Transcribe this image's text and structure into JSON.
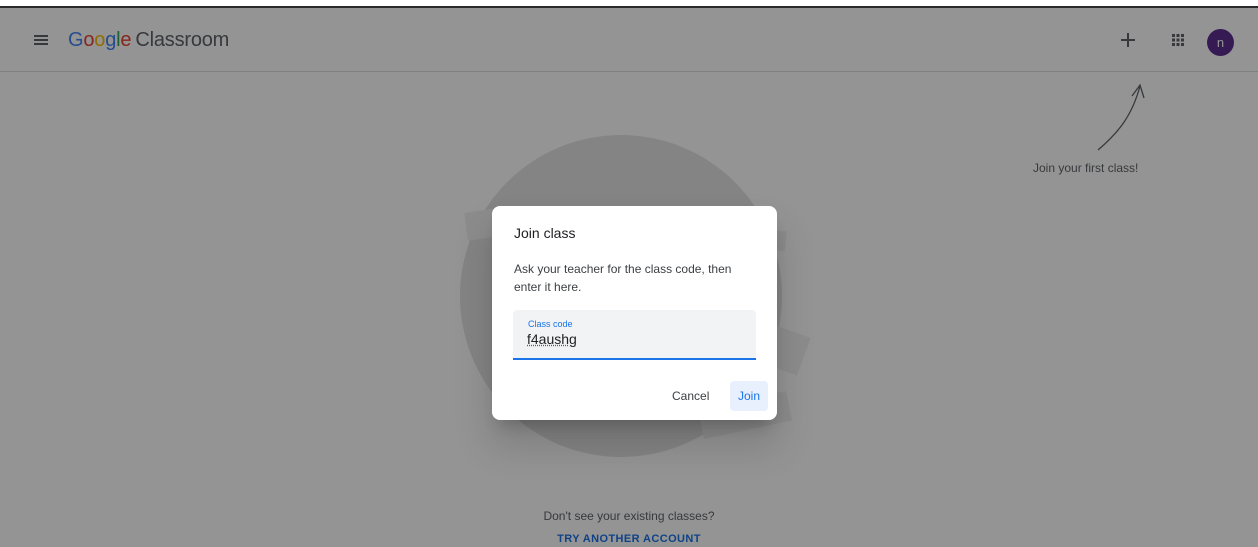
{
  "header": {
    "logo_google": [
      "G",
      "o",
      "o",
      "g",
      "l",
      "e"
    ],
    "logo_colors": [
      "#4285f4",
      "#ea4335",
      "#fbbc05",
      "#4285f4",
      "#34a853",
      "#ea4335"
    ],
    "logo_product": "Classroom",
    "avatar_initial": "n",
    "avatar_color": "#5c2d91",
    "icons": [
      "menu-icon",
      "plus-icon",
      "apps-grid-icon"
    ]
  },
  "main": {
    "hint_text": "Join your first class!",
    "footer_question": "Don't see your existing classes?",
    "footer_link": "TRY ANOTHER ACCOUNT"
  },
  "dialog": {
    "title": "Join class",
    "description": "Ask your teacher for the class code, then enter it here.",
    "field_label": "Class code",
    "field_value": "f4aushg",
    "cancel_label": "Cancel",
    "join_label": "Join"
  },
  "colors": {
    "accent": "#1a73e8",
    "scrim": "rgba(0,0,0,0.42)"
  }
}
